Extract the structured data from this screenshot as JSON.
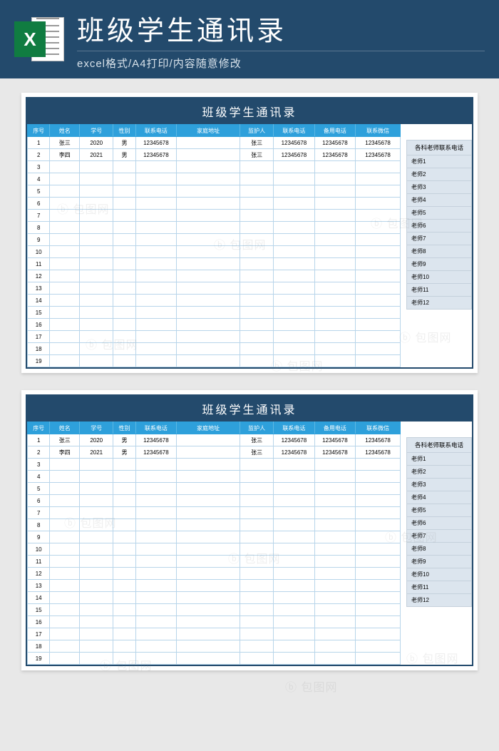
{
  "header": {
    "excel_x": "X",
    "main_title": "班级学生通讯录",
    "subtitle": "excel格式/A4打印/内容随意修改"
  },
  "card": {
    "title": "班级学生通讯录",
    "columns": [
      "序号",
      "姓名",
      "学号",
      "性别",
      "联系电话",
      "家庭地址",
      "监护人",
      "联系电话",
      "备用电话",
      "联系微信"
    ],
    "col_classes": [
      "col-seq",
      "col-name",
      "col-id",
      "col-sex",
      "col-tel",
      "col-addr",
      "col-guard",
      "col-gtel",
      "col-btel",
      "col-wx"
    ],
    "rows": [
      {
        "seq": "1",
        "name": "张三",
        "id": "2020",
        "sex": "男",
        "tel": "12345678",
        "addr": "",
        "guard": "张三",
        "gtel": "12345678",
        "btel": "12345678",
        "wx": "12345678"
      },
      {
        "seq": "2",
        "name": "李四",
        "id": "2021",
        "sex": "男",
        "tel": "12345678",
        "addr": "",
        "guard": "张三",
        "gtel": "12345678",
        "btel": "12345678",
        "wx": "12345678"
      },
      {
        "seq": "3"
      },
      {
        "seq": "4"
      },
      {
        "seq": "5"
      },
      {
        "seq": "6"
      },
      {
        "seq": "7"
      },
      {
        "seq": "8"
      },
      {
        "seq": "9"
      },
      {
        "seq": "10"
      },
      {
        "seq": "11"
      },
      {
        "seq": "12"
      },
      {
        "seq": "13"
      },
      {
        "seq": "14"
      },
      {
        "seq": "15"
      },
      {
        "seq": "16"
      },
      {
        "seq": "17"
      },
      {
        "seq": "18"
      },
      {
        "seq": "19"
      }
    ],
    "side_head": "各科老师联系电话",
    "teachers": [
      "老师1",
      "老师2",
      "老师3",
      "老师4",
      "老师5",
      "老师6",
      "老师7",
      "老师8",
      "老师9",
      "老师10",
      "老师11",
      "老师12"
    ]
  },
  "watermark": "包图网"
}
